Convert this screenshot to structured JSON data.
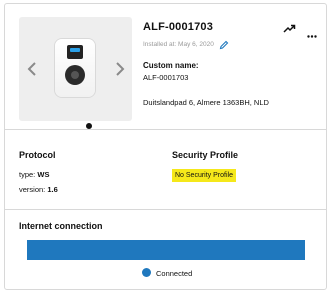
{
  "charger": {
    "id": "ALF-0001703",
    "installed": "Installed at: May 6, 2020",
    "custom_name_label": "Custom name:",
    "custom_name_value": "ALF-0001703",
    "address": "Duitslandpad 6, Almere 1363BH, NLD"
  },
  "protocol": {
    "heading": "Protocol",
    "type_label": "type:",
    "type_value": "WS",
    "version_label": "version:",
    "version_value": "1.6"
  },
  "security": {
    "heading": "Security Profile",
    "badge": "No Security Profile",
    "badge_color": "#f5e81a"
  },
  "internet": {
    "heading": "Internet connection",
    "legend": "Connected",
    "status_color": "#1f78be",
    "connected_fraction": 1.0
  },
  "icons": {
    "prev": "chevron-left-icon",
    "next": "chevron-right-icon",
    "edit": "pencil-icon",
    "trend": "trending-up-icon",
    "more": "more-horizontal-icon"
  }
}
